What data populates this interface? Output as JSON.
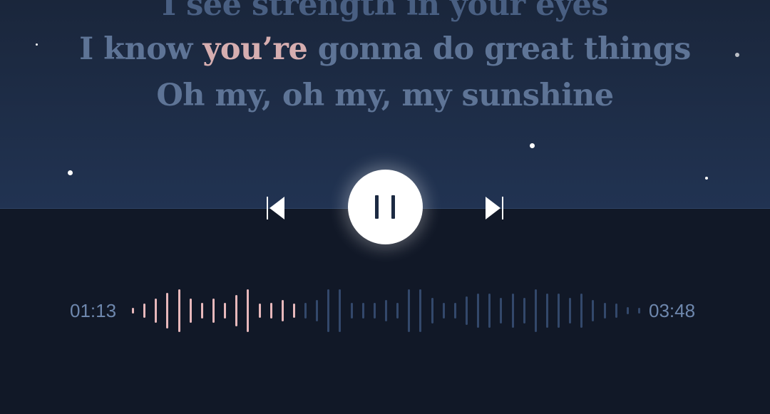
{
  "lyrics": {
    "line_top": "I see strength in your eyes",
    "line_current_before": "I know ",
    "line_current_highlight": "you’re",
    "line_current_after": " gonna do great things",
    "line_next": "Oh my, oh my, my sunshine"
  },
  "player": {
    "elapsed": "01:13",
    "duration": "03:48",
    "progress": 0.32,
    "state": "playing",
    "icons": {
      "previous": "skip-previous-icon",
      "play_pause": "pause-icon",
      "next": "skip-next-icon"
    }
  },
  "waveform": {
    "levels": [
      0.12,
      0.28,
      0.46,
      0.7,
      0.82,
      0.48,
      0.3,
      0.46,
      0.3,
      0.6,
      0.82,
      0.28,
      0.3,
      0.42,
      0.28,
      0.3,
      0.42,
      0.82,
      0.82,
      0.3,
      0.3,
      0.3,
      0.42,
      0.3,
      0.82,
      0.82,
      0.5,
      0.3,
      0.3,
      0.56,
      0.68,
      0.68,
      0.5,
      0.68,
      0.5,
      0.82,
      0.68,
      0.68,
      0.5,
      0.68,
      0.42,
      0.3,
      0.28,
      0.14,
      0.12
    ],
    "played_color": "#e7b8bb",
    "unplayed_color": "#33486b"
  },
  "colors": {
    "sky_top": "#1a263b",
    "sky_bottom": "#213352",
    "ground": "#111827",
    "lyric_muted": "#5e7496",
    "lyric_highlight": "#d6aeb0",
    "time_text": "#6e87ad"
  }
}
